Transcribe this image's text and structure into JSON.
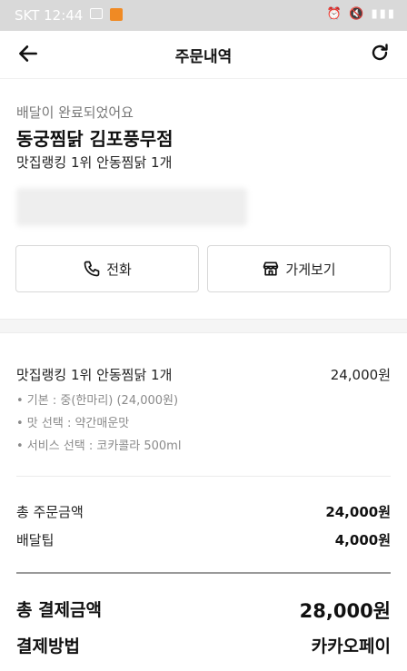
{
  "status_bar": {
    "carrier_time": "SKT 12:44"
  },
  "header": {
    "title": "주문내역"
  },
  "store": {
    "status_message": "배달이 완료되었어요",
    "name": "동궁찜닭 김포풍무점",
    "order_summary": "맛집랭킹 1위 안동찜닭 1개"
  },
  "actions": {
    "call_label": "전화",
    "store_label": "가게보기"
  },
  "order": {
    "item_name": "맛집랭킹 1위 안동찜닭 1개",
    "item_price": "24,000원",
    "options": [
      "• 기본 : 중(한마리) (24,000원)",
      "• 맛 선택 : 약간매운맛",
      "• 서비스 선택 : 코카콜라 500ml"
    ]
  },
  "summary": {
    "order_total_label": "총 주문금액",
    "order_total_value": "24,000원",
    "delivery_tip_label": "배달팁",
    "delivery_tip_value": "4,000원",
    "payment_total_label": "총 결제금액",
    "payment_total_value": "28,000원",
    "payment_method_label": "결제방법",
    "payment_method_value": "카카오페이"
  }
}
